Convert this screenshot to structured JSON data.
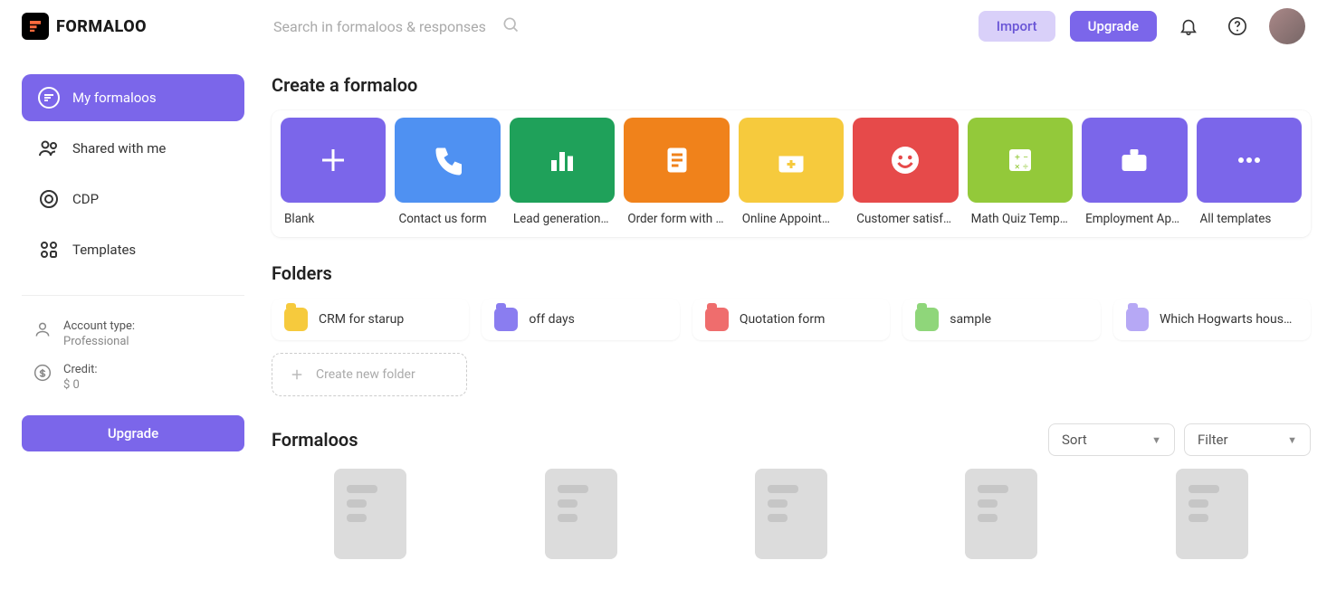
{
  "brand": "FORMALOO",
  "search": {
    "placeholder": "Search in formaloos & responses"
  },
  "topbar": {
    "import": "Import",
    "upgrade": "Upgrade"
  },
  "sidebar": {
    "items": [
      {
        "label": "My formaloos"
      },
      {
        "label": "Shared with me"
      },
      {
        "label": "CDP"
      },
      {
        "label": "Templates"
      }
    ],
    "account_type_label": "Account type:",
    "account_type_value": "Professional",
    "credit_label": "Credit:",
    "credit_value": "$ 0",
    "upgrade": "Upgrade"
  },
  "sections": {
    "create": "Create a formaloo",
    "folders": "Folders",
    "formaloos": "Formaloos"
  },
  "templates": [
    {
      "label": "Blank",
      "color": "#7b66ea",
      "icon": "plus"
    },
    {
      "label": "Contact us form",
      "color": "#4f91f2",
      "icon": "phone"
    },
    {
      "label": "Lead generation …",
      "color": "#1fa15a",
      "icon": "bars"
    },
    {
      "label": "Order form with …",
      "color": "#f0821b",
      "icon": "order"
    },
    {
      "label": "Online Appointm…",
      "color": "#f6ca3d",
      "icon": "calendar"
    },
    {
      "label": "Customer satisfa…",
      "color": "#e64a4a",
      "icon": "smile"
    },
    {
      "label": "Math Quiz Templ…",
      "color": "#93c93a",
      "icon": "calc"
    },
    {
      "label": "Employment App…",
      "color": "#7b66ea",
      "icon": "briefcase"
    },
    {
      "label": "All templates",
      "color": "#7b66ea",
      "icon": "dots"
    }
  ],
  "folders": [
    {
      "label": "CRM for starup",
      "color": "#f6ca3d"
    },
    {
      "label": "off days",
      "color": "#8a7df0"
    },
    {
      "label": "Quotation form",
      "color": "#ef6d6d"
    },
    {
      "label": "sample",
      "color": "#8fd67a"
    },
    {
      "label": "Which Hogwarts house …",
      "color": "#b6a8f5"
    }
  ],
  "new_folder": "Create new folder",
  "controls": {
    "sort": "Sort",
    "filter": "Filter"
  }
}
